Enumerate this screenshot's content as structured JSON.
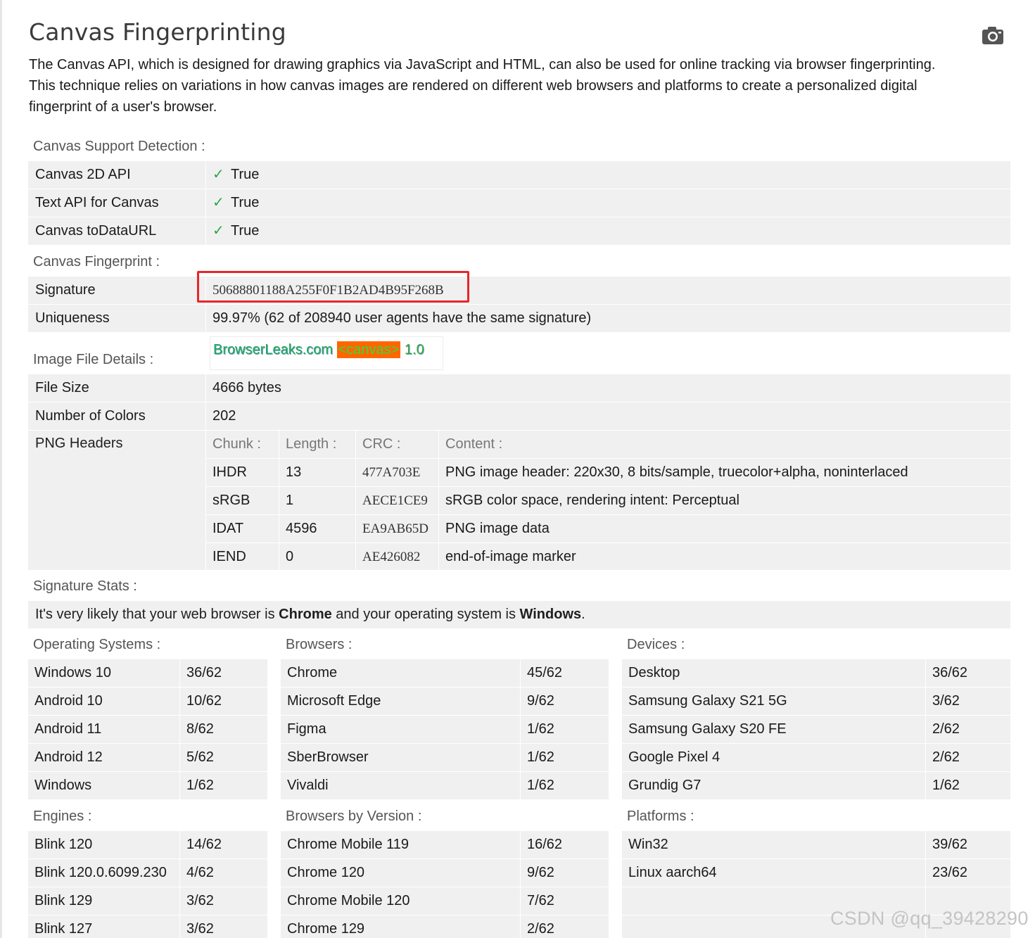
{
  "title": "Canvas Fingerprinting",
  "camera_icon": "camera-icon",
  "intro": [
    "The Canvas API, which is designed for drawing graphics via JavaScript and HTML, can also be used for online tracking via browser fingerprinting.",
    "This technique relies on variations in how canvas images are rendered on different web browsers and platforms to create a personalized digital",
    "fingerprint of a user's browser."
  ],
  "support": {
    "section": "Canvas Support Detection :",
    "rows": [
      {
        "label": "Canvas 2D API",
        "check": "✓",
        "value": "True"
      },
      {
        "label": "Text API for Canvas",
        "check": "✓",
        "value": "True"
      },
      {
        "label": "Canvas toDataURL",
        "check": "✓",
        "value": "True"
      }
    ]
  },
  "fingerprint": {
    "section": "Canvas Fingerprint :",
    "signature_label": "Signature",
    "signature": "50688801188A255F0F1B2AD4B95F268B",
    "uniqueness_label": "Uniqueness",
    "uniqueness": "99.97% (62 of 208940 user agents have the same signature)"
  },
  "image": {
    "section": "Image File Details :",
    "canvas_brand": "BrowserLeaks.com",
    "canvas_tag": "<canvas>",
    "canvas_version": "1.0",
    "file_size_label": "File Size",
    "file_size": "4666 bytes",
    "colors_label": "Number of Colors",
    "colors": "202",
    "png_label": "PNG Headers",
    "png_headers": [
      "Chunk :",
      "Length :",
      "CRC :",
      "Content :"
    ],
    "png_rows": [
      {
        "chunk": "IHDR",
        "length": "13",
        "crc": "477A703E",
        "content": "PNG image header: 220x30, 8 bits/sample, truecolor+alpha, noninterlaced"
      },
      {
        "chunk": "sRGB",
        "length": "1",
        "crc": "AECE1CE9",
        "content": "sRGB color space, rendering intent: Perceptual"
      },
      {
        "chunk": "IDAT",
        "length": "4596",
        "crc": "EA9AB65D",
        "content": "PNG image data"
      },
      {
        "chunk": "IEND",
        "length": "0",
        "crc": "AE426082",
        "content": "end-of-image marker"
      }
    ]
  },
  "stats": {
    "section": "Signature Stats :",
    "sentence_pre": "It's very likely that your web browser is ",
    "browser": "Chrome",
    "sentence_mid": " and your operating system is ",
    "os": "Windows",
    "sentence_end": "."
  },
  "tables": {
    "os": {
      "title": "Operating Systems :",
      "rows": [
        [
          "Windows 10",
          "36/62"
        ],
        [
          "Android 10",
          "10/62"
        ],
        [
          "Android 11",
          "8/62"
        ],
        [
          "Android 12",
          "5/62"
        ],
        [
          "Windows",
          "1/62"
        ]
      ]
    },
    "browsers": {
      "title": "Browsers :",
      "rows": [
        [
          "Chrome",
          "45/62"
        ],
        [
          "Microsoft Edge",
          "9/62"
        ],
        [
          "Figma",
          "1/62"
        ],
        [
          "SberBrowser",
          "1/62"
        ],
        [
          "Vivaldi",
          "1/62"
        ]
      ]
    },
    "devices": {
      "title": "Devices :",
      "rows": [
        [
          "Desktop",
          "36/62"
        ],
        [
          "Samsung Galaxy S21 5G",
          "3/62"
        ],
        [
          "Samsung Galaxy S20 FE",
          "2/62"
        ],
        [
          "Google Pixel 4",
          "2/62"
        ],
        [
          "Grundig G7",
          "1/62"
        ]
      ]
    },
    "engines": {
      "title": "Engines :",
      "rows": [
        [
          "Blink 120",
          "14/62"
        ],
        [
          "Blink 120.0.6099.230",
          "4/62"
        ],
        [
          "Blink 129",
          "3/62"
        ],
        [
          "Blink 127",
          "3/62"
        ]
      ]
    },
    "versions": {
      "title": "Browsers by Version :",
      "rows": [
        [
          "Chrome Mobile 119",
          "16/62"
        ],
        [
          "Chrome 120",
          "9/62"
        ],
        [
          "Chrome Mobile 120",
          "7/62"
        ],
        [
          "Chrome 129",
          "2/62"
        ]
      ]
    },
    "platforms": {
      "title": "Platforms :",
      "rows": [
        [
          "Win32",
          "39/62"
        ],
        [
          "Linux aarch64",
          "23/62"
        ],
        [
          "",
          ""
        ],
        [
          "",
          ""
        ]
      ]
    }
  },
  "watermark": "CSDN @qq_39428290",
  "colors": {
    "check": "#2ea44f",
    "highlight_border": "#e8262a",
    "row_bg": "#f0f0f0",
    "canvas_tag_bg": "#ff6600"
  }
}
